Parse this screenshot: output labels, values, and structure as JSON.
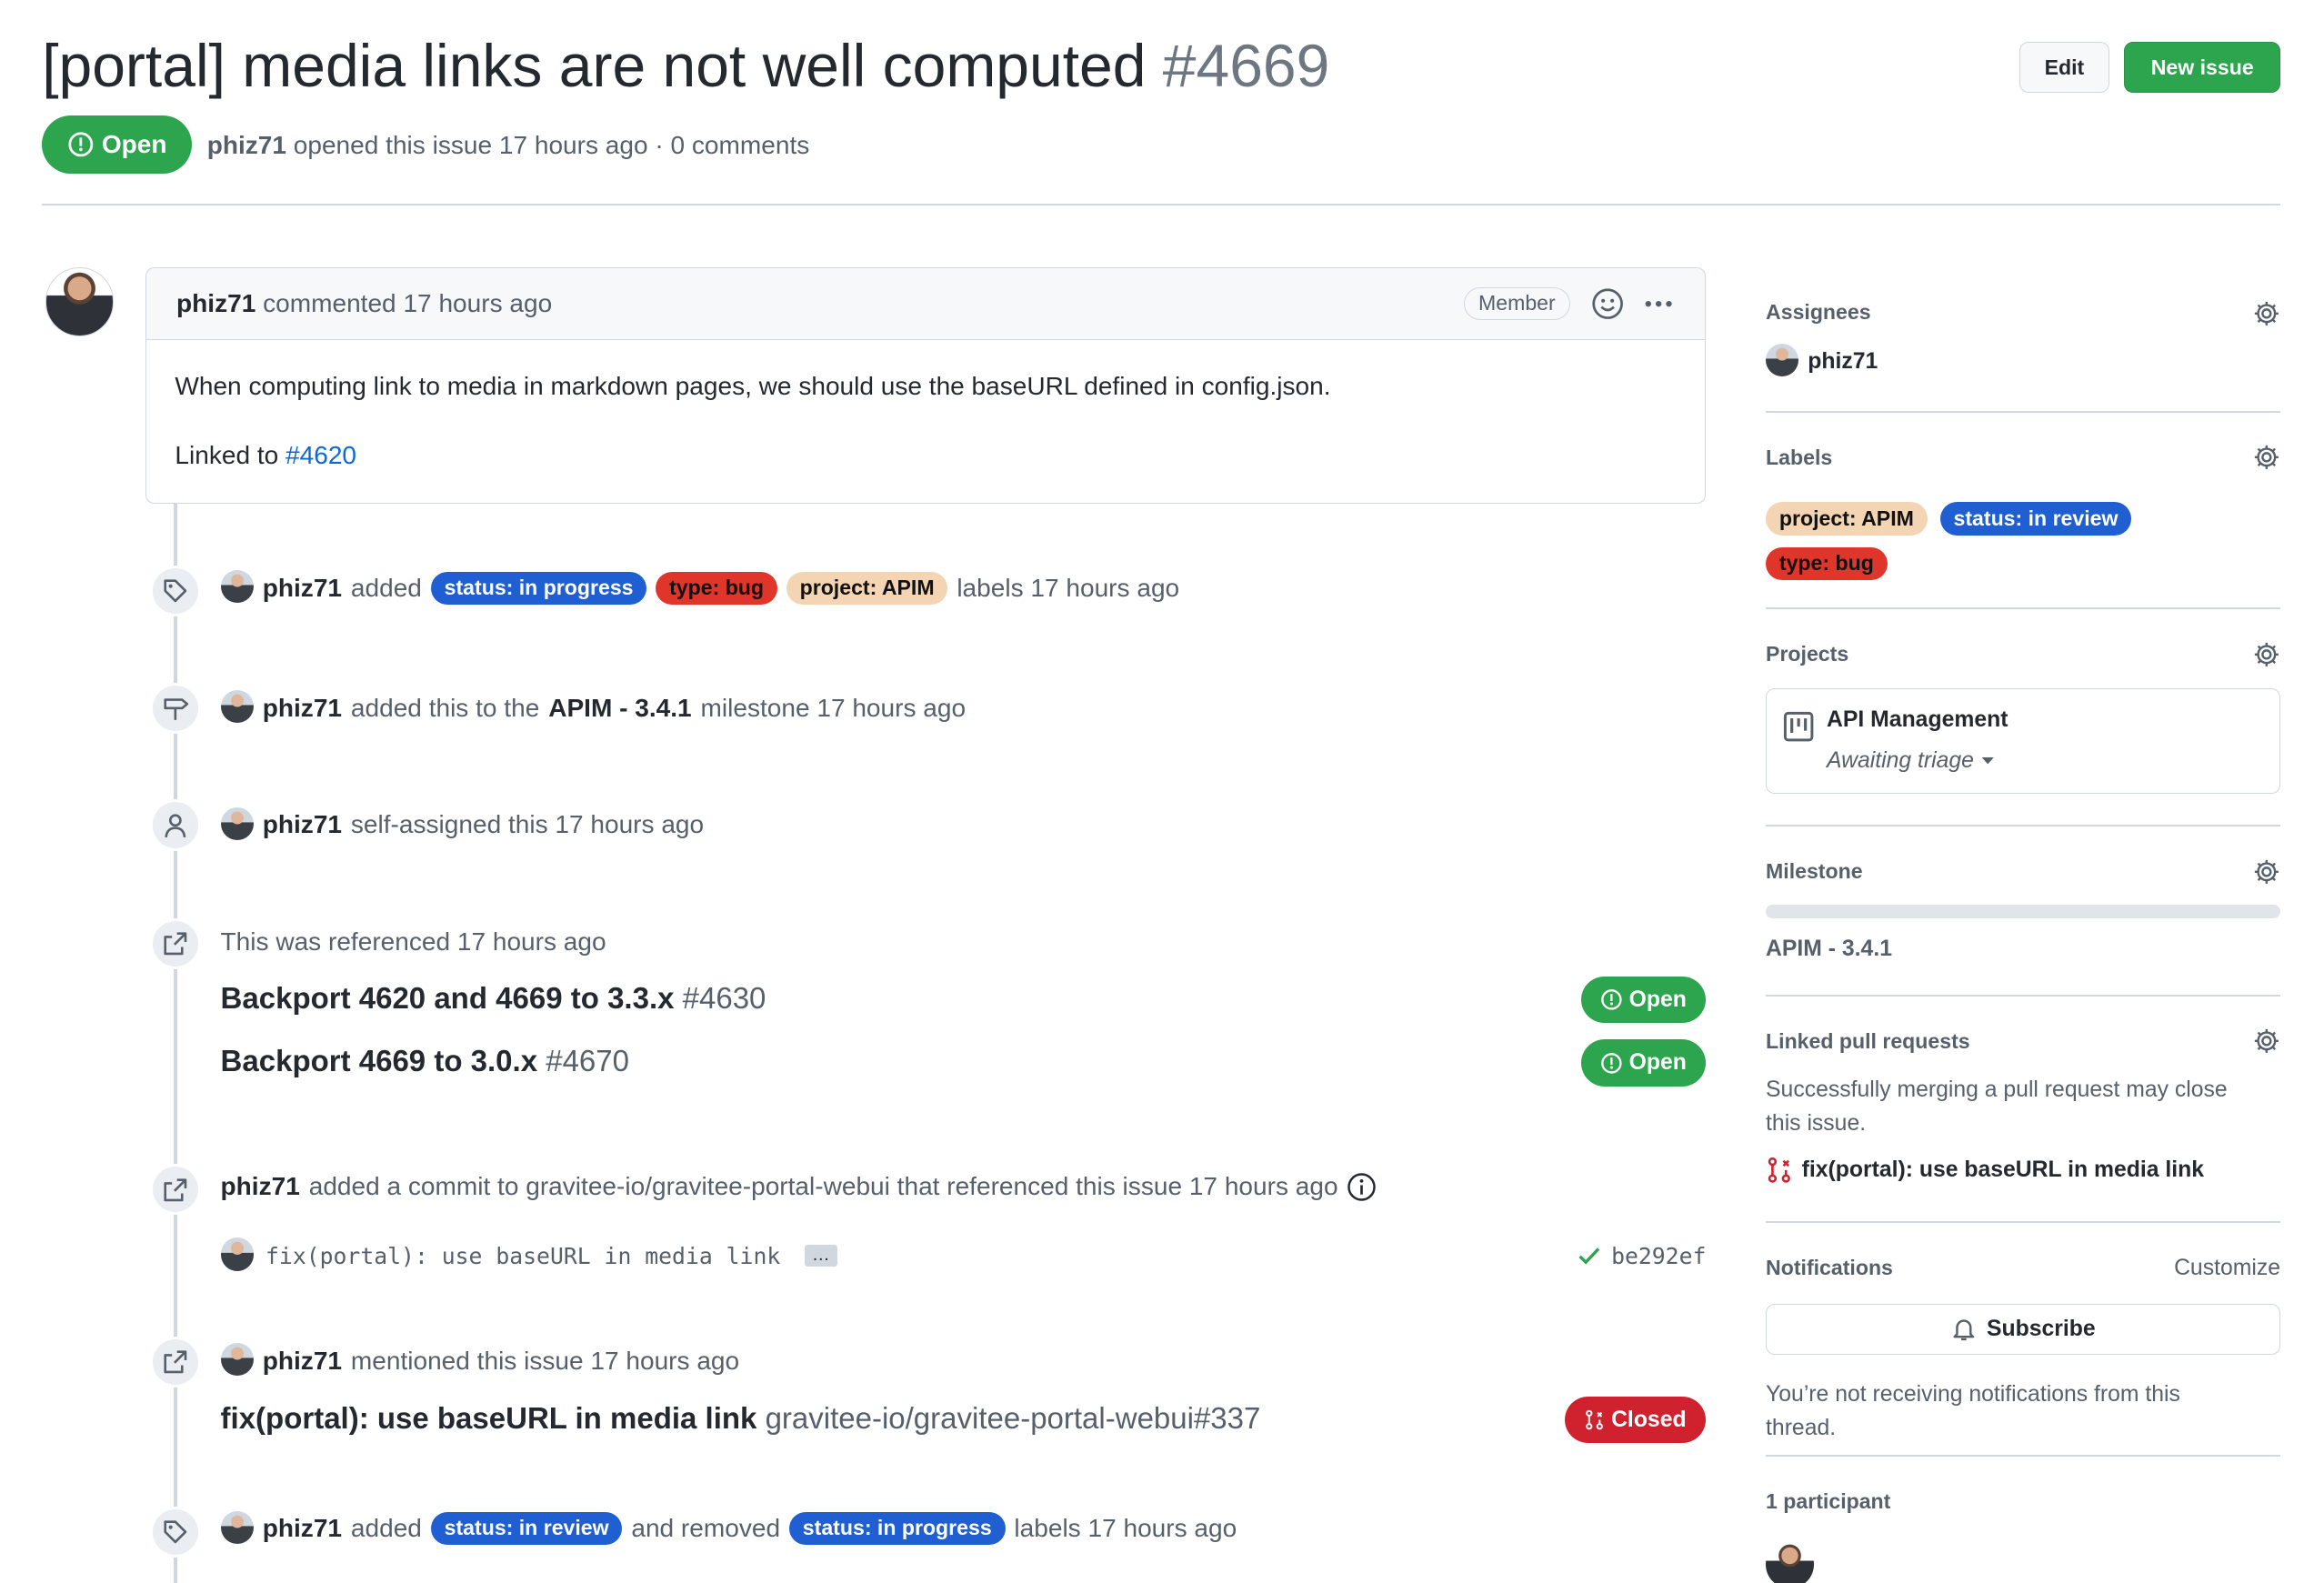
{
  "header": {
    "title": "[portal] media links are not well computed",
    "number": "#4669",
    "state": "Open",
    "author": "phiz71",
    "opened_text": "opened this issue 17 hours ago · 0 comments",
    "edit_label": "Edit",
    "new_issue_label": "New issue"
  },
  "comment": {
    "author": "phiz71",
    "meta": "commented 17 hours ago",
    "role_badge": "Member",
    "body_line1": "When computing link to media in markdown pages, we should use the baseURL defined in config.json.",
    "linked_prefix": "Linked to",
    "linked_ref": "#4620"
  },
  "timeline": {
    "labels_added": {
      "author": "phiz71",
      "verb": "added",
      "labels": [
        "status: in progress",
        "type: bug",
        "project: APIM"
      ],
      "suffix": "labels 17 hours ago"
    },
    "milestone": {
      "author": "phiz71",
      "prefix": "added this to the",
      "milestone": "APIM - 3.4.1",
      "suffix": "milestone 17 hours ago"
    },
    "assigned": {
      "author": "phiz71",
      "text": "self-assigned this 17 hours ago"
    },
    "referenced": {
      "text": "This was referenced 17 hours ago",
      "items": [
        {
          "title": "Backport 4620 and 4669 to 3.3.x",
          "number": "#4630",
          "state": "Open"
        },
        {
          "title": "Backport 4669 to 3.0.x",
          "number": "#4670",
          "state": "Open"
        }
      ]
    },
    "commit": {
      "author": "phiz71",
      "text": "added a commit to gravitee-io/gravitee-portal-webui that referenced this issue 17 hours ago",
      "message": "fix(portal): use baseURL in media link",
      "ellipsis": "…",
      "sha": "be292ef"
    },
    "mention": {
      "author": "phiz71",
      "text": "mentioned this issue 17 hours ago",
      "pr_title": "fix(portal): use baseURL in media link",
      "pr_ref": "gravitee-io/gravitee-portal-webui#337",
      "state": "Closed"
    },
    "labels_changed": {
      "author": "phiz71",
      "verb": "added",
      "added_label": "status: in review",
      "middle": "and removed",
      "removed_label": "status: in progress",
      "suffix": "labels 17 hours ago"
    }
  },
  "sidebar": {
    "assignees": {
      "heading": "Assignees",
      "user": "phiz71"
    },
    "labels": {
      "heading": "Labels",
      "items": [
        "project: APIM",
        "status: in review",
        "type: bug"
      ]
    },
    "projects": {
      "heading": "Projects",
      "name": "API Management",
      "status": "Awaiting triage"
    },
    "milestone": {
      "heading": "Milestone",
      "name": "APIM - 3.4.1",
      "progress": 0
    },
    "linked_prs": {
      "heading": "Linked pull requests",
      "description": "Successfully merging a pull request may close this issue.",
      "pr": "fix(portal): use baseURL in media link"
    },
    "notifications": {
      "heading": "Notifications",
      "customize": "Customize",
      "subscribe": "Subscribe",
      "note": "You’re not receiving notifications from this thread."
    },
    "participants": {
      "heading": "1 participant"
    }
  },
  "colors": {
    "open_green": "#2da44e",
    "closed_red": "#cf222e",
    "label_status_blue": "#1f5fd1",
    "label_bug_red": "#e0352b",
    "label_project_tan": "#f3d5b3",
    "link_blue": "#0969da"
  }
}
